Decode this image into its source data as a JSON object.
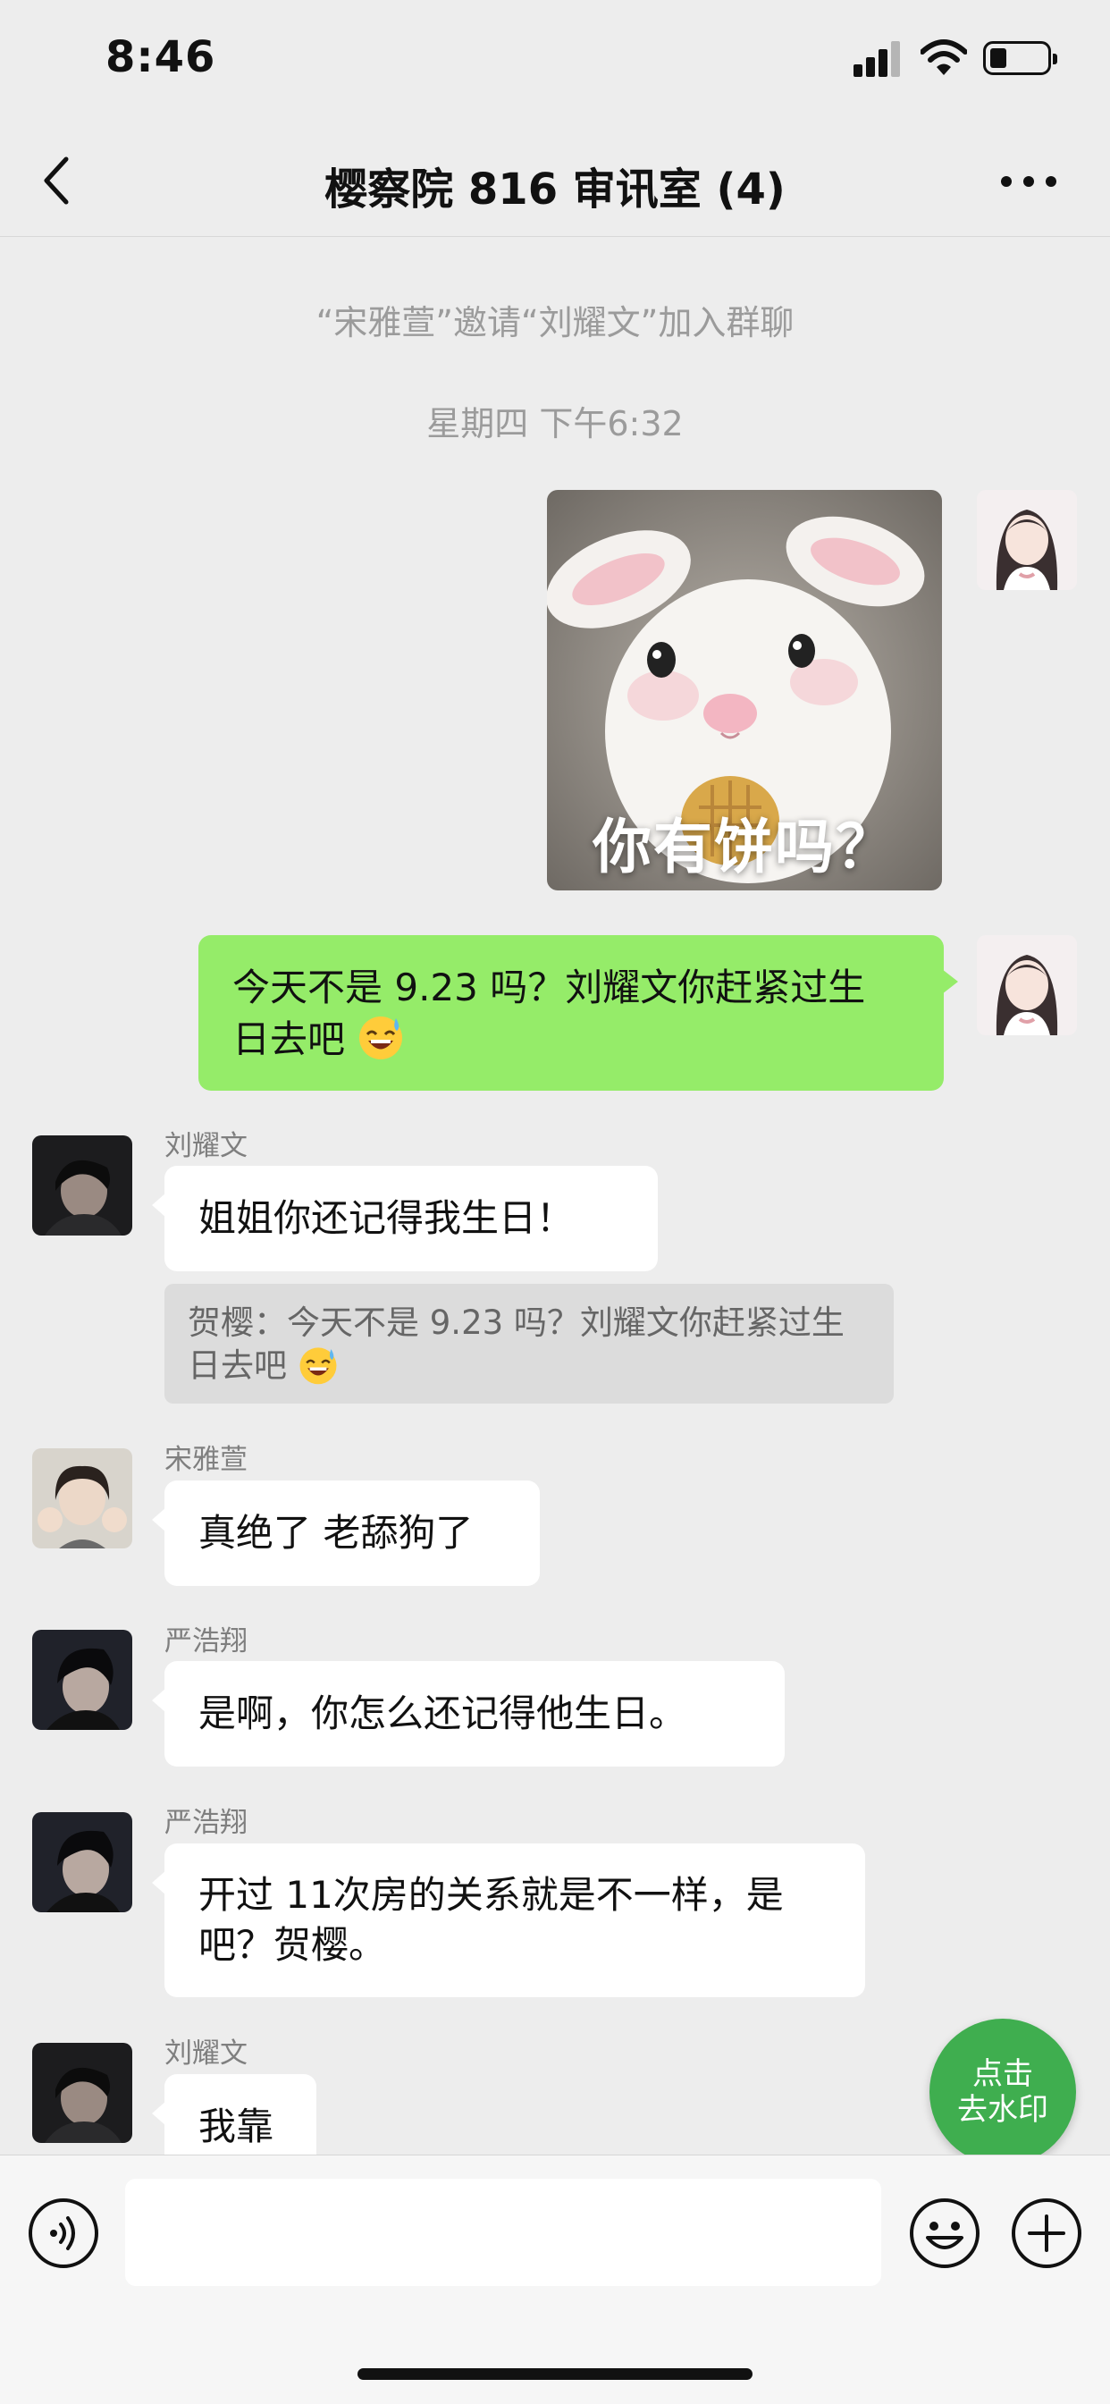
{
  "status": {
    "time": "8:46"
  },
  "header": {
    "title": "樱察院 816 审讯室 (4)"
  },
  "system_messages": {
    "invite": "“宋雅萱”邀请“刘耀文”加入群聊",
    "timestamp": "星期四 下午6:32"
  },
  "messages": [
    {
      "sender": "me",
      "type": "image",
      "caption": "你有饼吗？"
    },
    {
      "sender": "me",
      "type": "text",
      "line1": "今天不是 9.23 吗？刘耀文你赶紧过生",
      "line2": "日去吧"
    },
    {
      "sender": "刘耀文",
      "type": "text",
      "text": "姐姐你还记得我生日！",
      "quote": {
        "line1": "贺樱：今天不是 9.23 吗？刘耀文你赶紧过生",
        "line2": "日去吧"
      }
    },
    {
      "sender": "宋雅萱",
      "type": "text",
      "text": "真绝了 老舔狗了"
    },
    {
      "sender": "严浩翔",
      "type": "text",
      "text": "是啊，你怎么还记得他生日。"
    },
    {
      "sender": "严浩翔",
      "type": "text",
      "line1": "开过 11次房的关系就是不一样，是",
      "line2": "吧？贺樱。"
    },
    {
      "sender": "刘耀文",
      "type": "text",
      "text": "我靠"
    }
  ],
  "watermark_button": {
    "line1": "点击",
    "line2": "去水印"
  },
  "icons": [
    "back-arrow-icon",
    "more-icon",
    "voice-icon",
    "emoji-icon",
    "plus-icon"
  ],
  "colors": {
    "background": "#ededed",
    "my_bubble": "#95ec69",
    "their_bubble": "#ffffff",
    "fab": "#3fae4f"
  }
}
